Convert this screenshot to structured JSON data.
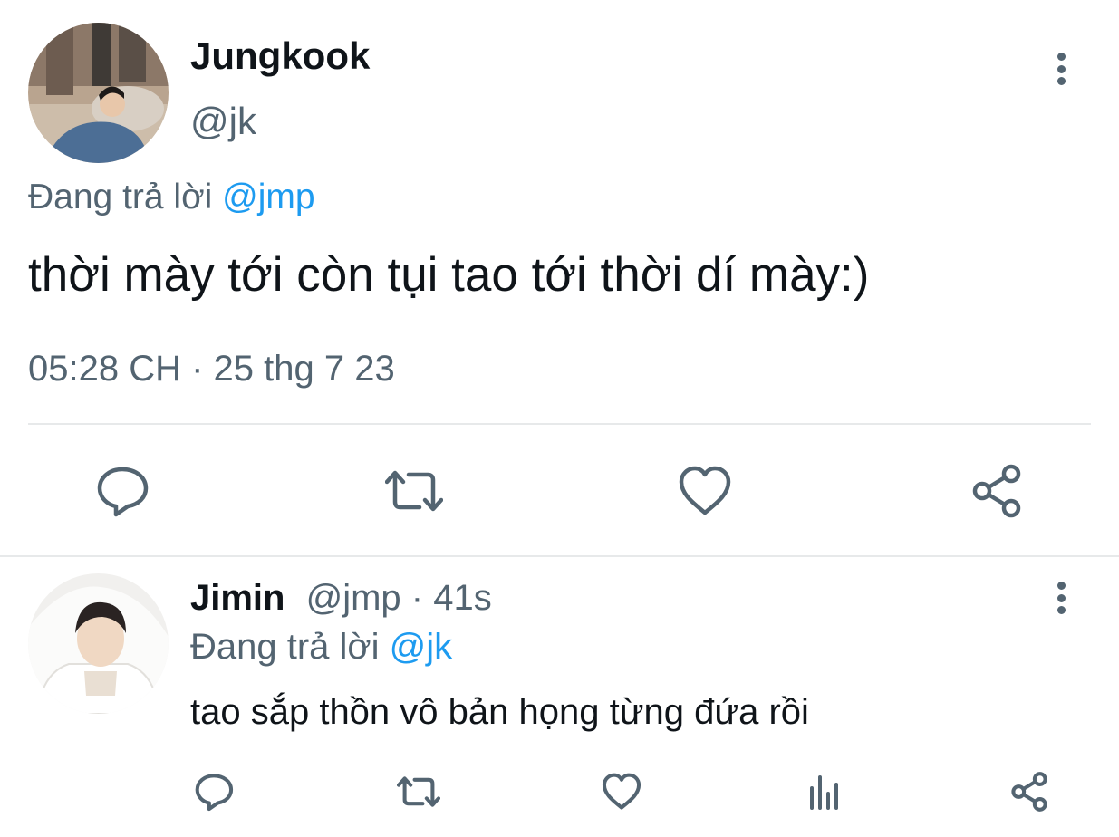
{
  "main_tweet": {
    "author_name": "Jungkook",
    "author_handle": "@jk",
    "reply_prefix": "Đang trả lời",
    "reply_to": "@jmp",
    "text": "thời mày tới còn tụi tao tới thời dí mày:)",
    "timestamp": "05:28 CH · 25 thg 7 23",
    "actions": [
      "reply-icon",
      "retweet-icon",
      "like-icon",
      "share-icon"
    ]
  },
  "reply_tweet": {
    "author_name": "Jimin",
    "author_handle": "@jmp",
    "separator": "·",
    "age": "41s",
    "reply_prefix": "Đang trả lời",
    "reply_to": "@jk",
    "text": "tao sắp thồn vô bản họng từng đứa rồi",
    "actions": [
      "reply-icon",
      "retweet-icon",
      "like-icon",
      "views-icon",
      "share-icon"
    ]
  },
  "colors": {
    "text": "#0f1419",
    "secondary": "#536471",
    "link": "#1d9bf0",
    "divider": "#e7e9ea"
  }
}
